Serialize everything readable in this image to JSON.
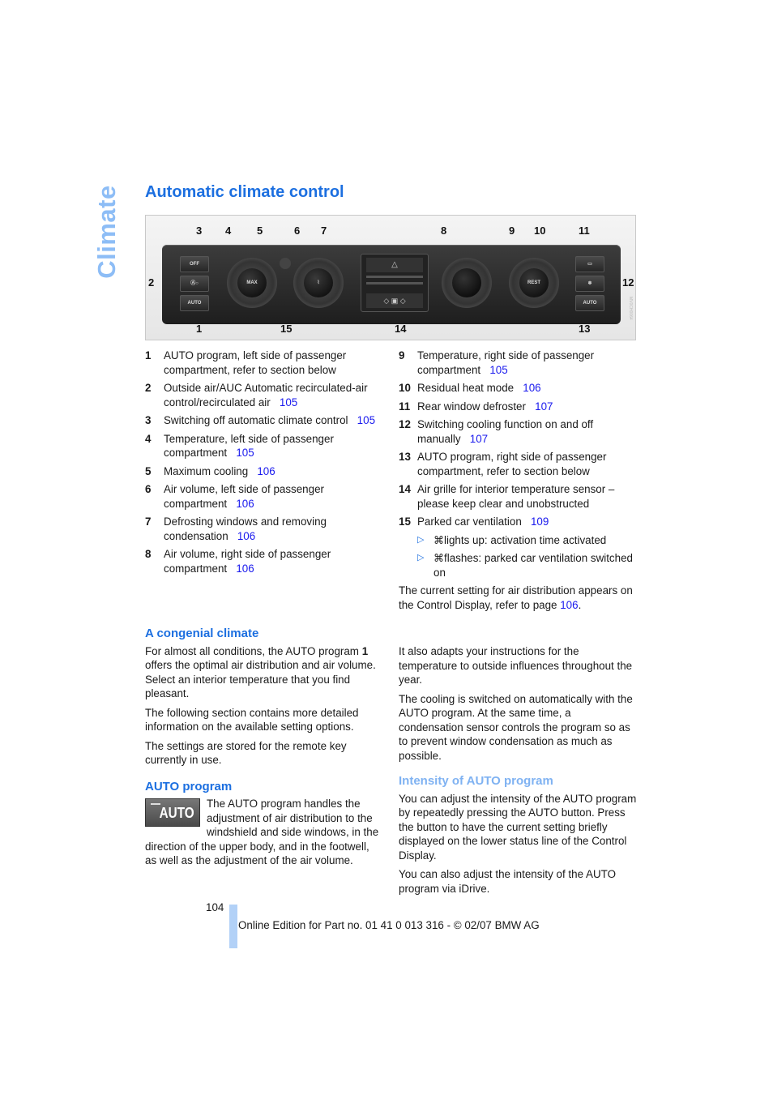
{
  "side_tab": "Climate",
  "title": "Automatic climate control",
  "figure": {
    "code": "MV0CH0064",
    "callouts": [
      "1",
      "2",
      "3",
      "4",
      "5",
      "6",
      "7",
      "8",
      "9",
      "10",
      "11",
      "12",
      "13",
      "14",
      "15"
    ],
    "buttons_left": [
      "OFF",
      "Ⓐ○",
      "AUTO"
    ],
    "buttons_right": [
      "▭",
      "❄",
      "AUTO"
    ],
    "knob_labels": {
      "left_temp": "MAX",
      "defrost": "⌇",
      "right_temp": "REST"
    }
  },
  "items_left": [
    {
      "num": "1",
      "text": "AUTO program, left side of passenger compartment, refer to section below",
      "page": ""
    },
    {
      "num": "2",
      "text": "Outside air/AUC Automatic recirculated-air control/recirculated air",
      "page": "105"
    },
    {
      "num": "3",
      "text": "Switching off automatic climate control",
      "page": "105"
    },
    {
      "num": "4",
      "text": "Temperature, left side of passenger compartment",
      "page": "105"
    },
    {
      "num": "5",
      "text": "Maximum cooling",
      "page": "106"
    },
    {
      "num": "6",
      "text": "Air volume, left side of passenger compartment",
      "page": "106"
    },
    {
      "num": "7",
      "text": "Defrosting windows and removing condensation",
      "page": "106"
    },
    {
      "num": "8",
      "text": "Air volume, right side of passenger compartment",
      "page": "106"
    }
  ],
  "items_right": [
    {
      "num": "9",
      "text": "Temperature, right side of passenger compartment",
      "page": "105"
    },
    {
      "num": "10",
      "text": "Residual heat mode",
      "page": "106"
    },
    {
      "num": "11",
      "text": "Rear window defroster",
      "page": "107"
    },
    {
      "num": "12",
      "text": "Switching cooling function on and off manually",
      "page": "107"
    },
    {
      "num": "13",
      "text": "AUTO program, right side of passenger compartment, refer to section below",
      "page": ""
    },
    {
      "num": "14",
      "text": "Air grille for interior temperature sensor – please keep clear and unobstructed",
      "page": ""
    },
    {
      "num": "15",
      "text": "Parked car ventilation",
      "page": "109"
    }
  ],
  "sub_items": [
    {
      "icon": "⌘",
      "text": "lights up: activation time activated"
    },
    {
      "icon": "⌘",
      "text": "flashes: parked car ventilation switched on"
    }
  ],
  "air_distribution_note": {
    "text": "The current setting for air distribution appears on the Control Display, refer to page ",
    "page": "106",
    "end": "."
  },
  "congenial": {
    "heading": "A congenial climate",
    "p1_pre": "For almost all conditions, the AUTO program ",
    "p1_bold": "1",
    "p1_post": " offers the optimal air distribution and air volume. Select an interior temperature that you find pleasant.",
    "p2": "The following section contains more detailed information on the available setting options.",
    "p3": "The settings are stored for the remote key currently in use."
  },
  "auto_program": {
    "heading": "AUTO program",
    "button_label": "AUTO",
    "text": "The AUTO program handles the adjustment of air distribution to the windshield and side windows, in the direction of the upper body, and in the footwell, as well as the adjustment of the air volume."
  },
  "right_col": {
    "p1": "It also adapts your instructions for the temperature to outside influences throughout the year.",
    "p2": "The cooling is switched on automatically with the AUTO program. At the same time, a condensation sensor controls the program so as to prevent window condensation as much as possible.",
    "intensity_heading": "Intensity of AUTO program",
    "p3": "You can adjust the intensity of the AUTO program by repeatedly pressing the AUTO button. Press the button to have the current setting briefly displayed on the lower status line of the Control Display.",
    "p4": "You can also adjust the intensity of the AUTO program via iDrive."
  },
  "footer": {
    "page_number": "104",
    "text": "Online Edition for Part no. 01 41 0 013 316 - © 02/07 BMW AG"
  }
}
